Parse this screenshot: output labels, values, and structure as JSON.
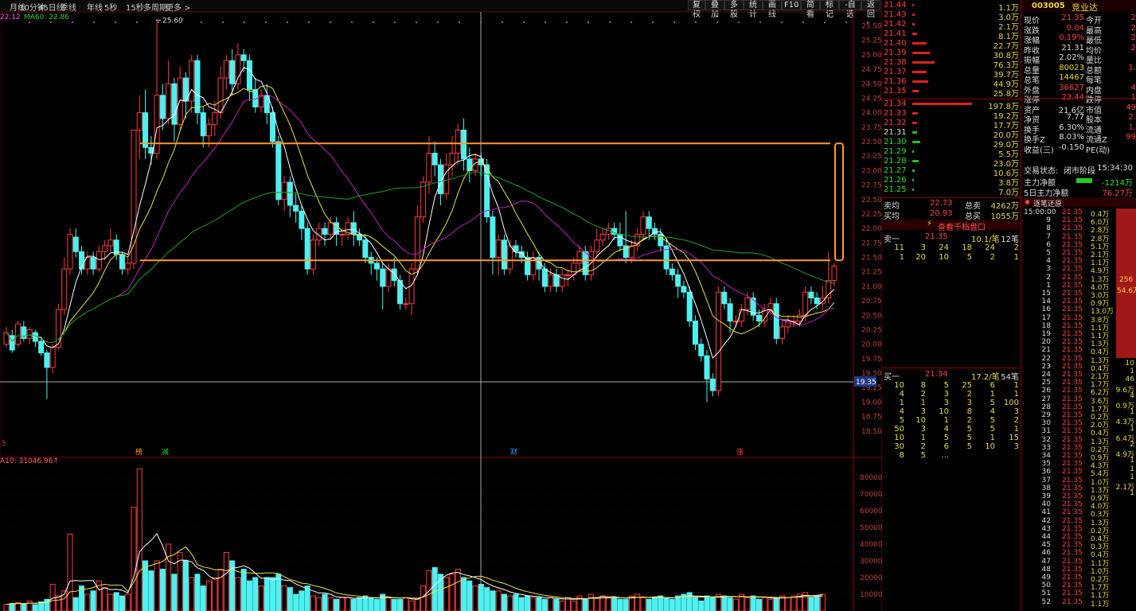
{
  "periods": [
    "月线",
    "10分钟",
    "45日线",
    "季线",
    "年线",
    "5秒",
    "15秒",
    "多周期",
    "更多 >"
  ],
  "toolbar": [
    "复权",
    "叠加",
    "多股",
    "统计",
    "画线",
    "F10",
    "简看",
    "标记",
    "-自选",
    "返回"
  ],
  "ma_legend": {
    "ma_partial": "22.12",
    "ma60": "MA60: 22.86"
  },
  "price_axis": [
    "25.50",
    "25.25",
    "25.00",
    "24.75",
    "24.50",
    "24.25",
    "24.00",
    "23.75",
    "23.50",
    "23.25",
    "23.00",
    "22.75",
    "22.50",
    "22.25",
    "22.00",
    "21.75",
    "21.50",
    "21.25",
    "21.00",
    "20.75",
    "20.50",
    "20.25",
    "20.00",
    "19.75",
    "19.50",
    "19.25",
    "19.00",
    "18.75",
    "18.50"
  ],
  "price_marker": "19.35",
  "high_label": "25.60",
  "chart_left_label": "5",
  "event_markers": [
    "榜",
    "减",
    "财",
    "涨"
  ],
  "vol_header": "A10: 31046.96↑",
  "vol_axis": [
    "80000",
    "70000",
    "60000",
    "50000",
    "40000",
    "30000",
    "20000",
    "10000"
  ],
  "candles": [
    [
      20.0,
      20.2,
      19.95,
      20.3
    ],
    [
      20.15,
      19.9,
      19.85,
      20.25
    ],
    [
      20.0,
      20.35,
      19.95,
      20.4
    ],
    [
      20.3,
      20.1,
      20.05,
      20.4
    ],
    [
      20.1,
      20.25,
      20.0,
      20.3
    ],
    [
      20.2,
      20.05,
      19.95,
      20.25
    ],
    [
      20.05,
      19.85,
      19.8,
      20.1
    ],
    [
      19.85,
      19.6,
      19.05,
      19.9
    ],
    [
      19.6,
      19.95,
      19.5,
      20.0
    ],
    [
      19.95,
      20.6,
      19.9,
      20.7
    ],
    [
      20.6,
      21.3,
      20.5,
      21.5
    ],
    [
      21.3,
      21.9,
      21.2,
      22.0
    ],
    [
      21.85,
      21.6,
      21.5,
      22.0
    ],
    [
      21.6,
      21.3,
      21.2,
      21.7
    ],
    [
      21.3,
      21.5,
      21.2,
      21.6
    ],
    [
      21.5,
      21.3,
      21.2,
      21.6
    ],
    [
      21.3,
      21.6,
      21.25,
      21.7
    ],
    [
      21.6,
      21.7,
      21.45,
      21.8
    ],
    [
      21.7,
      21.8,
      21.6,
      22.0
    ],
    [
      21.8,
      21.55,
      21.45,
      21.9
    ],
    [
      21.55,
      21.3,
      21.2,
      21.6
    ],
    [
      21.3,
      21.4,
      21.2,
      21.5
    ],
    [
      21.4,
      23.7,
      21.3,
      23.7
    ],
    [
      23.7,
      24.0,
      23.2,
      24.3
    ],
    [
      24.0,
      23.4,
      23.2,
      24.4
    ],
    [
      23.4,
      23.3,
      23.1,
      23.6
    ],
    [
      23.3,
      24.3,
      23.2,
      25.6
    ],
    [
      24.3,
      23.9,
      23.7,
      24.5
    ],
    [
      23.9,
      24.5,
      23.8,
      24.9
    ],
    [
      24.5,
      23.8,
      23.5,
      24.6
    ],
    [
      23.8,
      24.6,
      23.7,
      24.8
    ],
    [
      24.6,
      24.2,
      23.9,
      24.7
    ],
    [
      24.2,
      24.9,
      24.0,
      25.0
    ],
    [
      24.9,
      24.0,
      23.8,
      25.0
    ],
    [
      24.0,
      23.6,
      23.4,
      24.1
    ],
    [
      23.6,
      23.8,
      23.4,
      23.9
    ],
    [
      23.8,
      24.0,
      23.6,
      24.2
    ],
    [
      24.0,
      24.6,
      23.9,
      24.8
    ],
    [
      24.6,
      24.9,
      24.4,
      25.0
    ],
    [
      24.9,
      24.5,
      24.3,
      25.1
    ],
    [
      24.5,
      25.0,
      24.4,
      25.2
    ],
    [
      25.0,
      24.9,
      24.7,
      25.1
    ],
    [
      24.9,
      24.4,
      24.2,
      25.0
    ],
    [
      24.4,
      24.1,
      24.0,
      24.6
    ],
    [
      24.1,
      24.3,
      24.0,
      24.4
    ],
    [
      24.3,
      24.0,
      23.8,
      24.5
    ],
    [
      24.0,
      23.5,
      23.4,
      24.1
    ],
    [
      23.5,
      22.5,
      22.4,
      23.6
    ],
    [
      22.5,
      22.8,
      22.3,
      22.9
    ],
    [
      22.8,
      22.4,
      22.2,
      22.9
    ],
    [
      22.4,
      22.3,
      22.1,
      22.6
    ],
    [
      22.3,
      22.0,
      21.8,
      22.4
    ],
    [
      22.0,
      21.3,
      21.2,
      22.1
    ],
    [
      21.3,
      21.8,
      21.2,
      21.9
    ],
    [
      21.8,
      22.0,
      21.7,
      22.1
    ],
    [
      22.0,
      21.9,
      21.7,
      22.1
    ],
    [
      21.9,
      22.1,
      21.8,
      22.2
    ],
    [
      22.1,
      21.9,
      21.7,
      22.2
    ],
    [
      21.9,
      21.9,
      21.7,
      22.0
    ],
    [
      21.9,
      22.1,
      21.8,
      22.2
    ],
    [
      22.1,
      21.9,
      21.7,
      22.3
    ],
    [
      21.9,
      21.8,
      21.7,
      22.0
    ],
    [
      21.8,
      21.5,
      21.4,
      21.9
    ],
    [
      21.5,
      21.4,
      21.2,
      21.6
    ],
    [
      21.4,
      21.3,
      21.1,
      21.5
    ],
    [
      21.3,
      21.0,
      20.6,
      21.4
    ],
    [
      21.0,
      21.3,
      20.9,
      21.4
    ],
    [
      21.3,
      21.1,
      21.0,
      21.5
    ],
    [
      21.1,
      20.7,
      20.6,
      21.2
    ],
    [
      20.7,
      20.7,
      20.6,
      20.8
    ],
    [
      20.7,
      21.3,
      20.5,
      21.4
    ],
    [
      21.3,
      22.2,
      21.2,
      22.4
    ],
    [
      22.2,
      22.8,
      22.1,
      22.9
    ],
    [
      22.8,
      23.3,
      22.6,
      23.6
    ],
    [
      23.3,
      23.1,
      22.9,
      23.5
    ],
    [
      23.1,
      22.6,
      22.4,
      23.2
    ],
    [
      22.6,
      23.1,
      22.5,
      23.3
    ],
    [
      23.1,
      23.3,
      22.9,
      23.6
    ],
    [
      23.3,
      23.7,
      23.1,
      23.8
    ],
    [
      23.7,
      23.2,
      23.0,
      23.9
    ],
    [
      23.2,
      23.0,
      22.8,
      23.4
    ],
    [
      23.0,
      23.2,
      22.9,
      23.3
    ],
    [
      23.2,
      23.1,
      22.9,
      23.3
    ],
    [
      23.1,
      22.2,
      22.1,
      23.2
    ],
    [
      22.2,
      21.5,
      21.2,
      22.3
    ],
    [
      21.5,
      21.8,
      21.2,
      21.9
    ],
    [
      21.8,
      21.3,
      21.2,
      21.9
    ],
    [
      21.3,
      21.7,
      21.2,
      21.8
    ],
    [
      21.7,
      21.6,
      21.5,
      21.8
    ],
    [
      21.6,
      21.5,
      21.4,
      21.7
    ],
    [
      21.5,
      21.2,
      21.1,
      21.6
    ],
    [
      21.2,
      21.5,
      21.1,
      21.6
    ],
    [
      21.5,
      21.3,
      21.1,
      21.6
    ],
    [
      21.3,
      21.0,
      20.9,
      21.4
    ],
    [
      21.0,
      21.2,
      20.9,
      21.3
    ],
    [
      21.2,
      21.0,
      20.9,
      21.3
    ],
    [
      21.0,
      21.2,
      20.9,
      21.3
    ],
    [
      21.2,
      21.2,
      21.0,
      21.3
    ],
    [
      21.2,
      21.4,
      21.1,
      21.5
    ],
    [
      21.4,
      21.6,
      21.3,
      21.7
    ],
    [
      21.6,
      21.2,
      21.1,
      21.7
    ],
    [
      21.2,
      21.6,
      21.1,
      21.7
    ],
    [
      21.6,
      21.8,
      21.5,
      22.0
    ],
    [
      21.8,
      21.9,
      21.7,
      22.0
    ],
    [
      21.9,
      22.0,
      21.8,
      22.1
    ],
    [
      22.0,
      21.9,
      21.8,
      22.1
    ],
    [
      21.9,
      21.7,
      21.6,
      22.1
    ],
    [
      21.7,
      21.5,
      21.4,
      22.3
    ],
    [
      21.5,
      21.7,
      21.4,
      21.8
    ],
    [
      21.7,
      21.9,
      21.6,
      22.0
    ],
    [
      21.9,
      22.2,
      21.8,
      22.3
    ],
    [
      22.2,
      22.0,
      21.8,
      22.3
    ],
    [
      22.0,
      21.9,
      21.8,
      22.1
    ],
    [
      21.9,
      21.7,
      21.6,
      22.0
    ],
    [
      21.7,
      21.3,
      21.2,
      21.8
    ],
    [
      21.3,
      21.2,
      21.1,
      21.4
    ],
    [
      21.2,
      21.0,
      20.8,
      21.3
    ],
    [
      21.0,
      20.9,
      20.8,
      21.1
    ],
    [
      20.9,
      20.4,
      20.3,
      21.0
    ],
    [
      20.4,
      20.0,
      19.9,
      20.5
    ],
    [
      20.0,
      19.8,
      19.7,
      20.1
    ],
    [
      19.8,
      19.4,
      19.0,
      19.9
    ],
    [
      19.4,
      19.2,
      19.1,
      19.5
    ],
    [
      19.2,
      20.9,
      19.1,
      21.0
    ],
    [
      20.9,
      20.7,
      20.6,
      21.0
    ],
    [
      20.7,
      20.4,
      20.2,
      20.8
    ],
    [
      20.4,
      20.4,
      20.3,
      20.5
    ],
    [
      20.4,
      20.6,
      20.3,
      20.7
    ],
    [
      20.6,
      20.8,
      20.5,
      20.9
    ],
    [
      20.8,
      20.5,
      20.4,
      20.9
    ],
    [
      20.5,
      20.4,
      20.3,
      20.6
    ],
    [
      20.4,
      20.6,
      20.3,
      20.7
    ],
    [
      20.6,
      20.7,
      20.5,
      20.8
    ],
    [
      20.7,
      20.1,
      20.0,
      20.8
    ],
    [
      20.1,
      20.3,
      20.0,
      20.4
    ],
    [
      20.3,
      20.4,
      20.2,
      20.5
    ],
    [
      20.4,
      20.4,
      20.3,
      20.5
    ],
    [
      20.4,
      20.5,
      20.3,
      20.6
    ],
    [
      20.5,
      20.9,
      20.4,
      21.0
    ],
    [
      20.9,
      20.8,
      20.7,
      21.0
    ],
    [
      20.8,
      20.7,
      20.6,
      20.9
    ],
    [
      20.7,
      20.8,
      20.6,
      21.0
    ],
    [
      20.8,
      21.1,
      20.7,
      21.6
    ],
    [
      21.1,
      21.35,
      21.0,
      21.4
    ]
  ],
  "volumes": [
    4000,
    4500,
    5000,
    4200,
    6000,
    3800,
    5500,
    7000,
    16000,
    9000,
    12000,
    46000,
    8000,
    15000,
    10000,
    12000,
    18000,
    14000,
    10000,
    11000,
    9000,
    10000,
    62000,
    85000,
    30000,
    24000,
    30000,
    25000,
    40000,
    22000,
    35000,
    30000,
    20000,
    22000,
    15000,
    18000,
    20000,
    25000,
    35000,
    30000,
    20000,
    25000,
    18000,
    20000,
    15000,
    20000,
    20000,
    22000,
    15000,
    14000,
    10000,
    12000,
    15000,
    9000,
    8000,
    10000,
    8000,
    7000,
    8000,
    8000,
    7000,
    8000,
    9000,
    8000,
    7000,
    10000,
    8000,
    7000,
    7000,
    8000,
    6000,
    7000,
    15000,
    24000,
    26000,
    22000,
    20000,
    22000,
    25000,
    20000,
    18000,
    15000,
    16000,
    14000,
    12000,
    12000,
    10000,
    9000,
    10000,
    8000,
    9000,
    8000,
    8000,
    7000,
    8000,
    7000,
    6000,
    8000,
    6000,
    9000,
    7000,
    10000,
    8000,
    9000,
    8000,
    8000,
    7000,
    7000,
    9000,
    10000,
    8000,
    7000,
    8000,
    9000,
    8000,
    7000,
    9000,
    10000,
    11000,
    8000,
    6000,
    9000,
    8000,
    10000,
    9000,
    8000,
    7000,
    10000,
    8000,
    9000,
    7000,
    8000,
    7000,
    8000,
    9000,
    8000,
    9000,
    10000,
    11000,
    8000,
    9000,
    10000
  ],
  "right_panel": {
    "ask_rows": [
      [
        "21.44",
        "1.1万"
      ],
      [
        "21.43",
        "3.0万"
      ],
      [
        "21.42",
        "2.1万"
      ],
      [
        "21.41",
        "8.1万"
      ],
      [
        "21.40",
        "22.7万"
      ],
      [
        "21.39",
        "30.8万"
      ],
      [
        "21.38",
        "76.3万"
      ],
      [
        "21.37",
        "39.7万"
      ],
      [
        "21.36",
        "44.9万"
      ],
      [
        "21.35",
        "25.8万"
      ]
    ],
    "bid_rows": [
      [
        "21.34",
        "197.8万"
      ],
      [
        "21.33",
        "19.2万"
      ],
      [
        "21.32",
        "17.7万"
      ],
      [
        "21.31",
        "20.0万"
      ],
      [
        "21.30",
        "29.0万"
      ],
      [
        "21.29",
        "5.5万"
      ],
      [
        "21.28",
        "23.0万"
      ],
      [
        "21.27",
        "10.6万"
      ],
      [
        "21.26",
        "3.8万"
      ],
      [
        "21.25",
        "7.0万"
      ]
    ],
    "summary": [
      [
        "卖均",
        "22.73",
        "总卖",
        "4262万"
      ],
      [
        "买均",
        "20.93",
        "总买",
        "1055万"
      ]
    ],
    "view_link": "查看千档盘口",
    "sell1": [
      "卖一",
      "21.35",
      "10.1/笔",
      "12笔"
    ],
    "sell_grid": [
      [
        "11",
        "3",
        "24",
        "18",
        "24",
        "2"
      ],
      [
        "1",
        "20",
        "10",
        "5",
        "2",
        "1"
      ]
    ],
    "buy1": [
      "买一",
      "21.34",
      "17.2/笔",
      "54笔"
    ],
    "buy_grid": [
      [
        "10",
        "8",
        "5",
        "25",
        "6",
        "1"
      ],
      [
        "4",
        "2",
        "3",
        "2",
        "1",
        "1"
      ],
      [
        "1",
        "1",
        "3",
        "3",
        "5",
        "100"
      ],
      [
        "4",
        "3",
        "10",
        "8",
        "4",
        "3"
      ],
      [
        "5",
        "10",
        "1",
        "2",
        "5",
        "2"
      ],
      [
        "50",
        "3",
        "4",
        "5",
        "5",
        "1"
      ],
      [
        "10",
        "1",
        "5",
        "5",
        "1",
        "15"
      ],
      [
        "30",
        "2",
        "6",
        "5",
        "10",
        "3"
      ],
      [
        "8",
        "5",
        "...",
        "",
        "",
        ""
      ]
    ]
  },
  "quote": {
    "code": "003005",
    "name": "竞业达",
    "rows": [
      [
        "现价",
        "21.35",
        "今开",
        "2"
      ],
      [
        "涨跌",
        "0.04",
        "最高",
        "2"
      ],
      [
        "涨幅",
        "0.19%",
        "最低",
        "2"
      ],
      [
        "昨收",
        "21.31",
        "均价",
        "2"
      ],
      [
        "振幅",
        "2.02%",
        "量比",
        ""
      ],
      [
        "总量",
        "80023",
        "总额",
        "1."
      ],
      [
        "总笔",
        "14467",
        "每笔",
        ""
      ],
      [
        "外盘",
        "36627",
        "内盘",
        "4"
      ],
      [
        "涨停",
        "23.44",
        "跌停",
        "1"
      ],
      [
        "资产",
        "21.6亿",
        "市值",
        "49"
      ],
      [
        "净资",
        "7.77",
        "股本",
        "2."
      ],
      [
        "换手",
        "6.30%",
        "流通",
        "1."
      ],
      [
        "换手Z",
        "8.03%",
        "流通Z",
        "99"
      ],
      [
        "收益(三)",
        "-0.150",
        "PE(动)",
        ""
      ]
    ],
    "trade_status": "交易状态:",
    "trade_status_value": "闭市阶段",
    "trade_time": "15:34:30",
    "mainforce": "主力净额",
    "mainforce_value": "-1214万",
    "mainforce5": "5日主力净额",
    "mainforce5_value": "76.27万",
    "tick_tab": "逐笔还原"
  },
  "ticks": {
    "time": "15:00:00",
    "rows": [
      [
        "",
        "21.35",
        "0.4万"
      ],
      [
        "9",
        "21.35",
        "6.0万"
      ],
      [
        "8",
        "21.35",
        "2.8万"
      ],
      [
        "7",
        "21.35",
        "2.8万"
      ],
      [
        "6",
        "21.35",
        "5.1万"
      ],
      [
        "5",
        "21.35",
        "2.1万"
      ],
      [
        "4",
        "21.35",
        "1.1万"
      ],
      [
        "3",
        "21.35",
        "4.9万"
      ],
      [
        "2",
        "21.35",
        "1.3万"
      ],
      [
        "1",
        "21.35",
        "4.0万"
      ],
      [
        "15",
        "21.35",
        "3.0万"
      ],
      [
        "14",
        "21.35",
        "0.9万"
      ],
      [
        "16",
        "21.35",
        "13.0万"
      ],
      [
        "17",
        "21.35",
        "3.8万"
      ],
      [
        "18",
        "21.35",
        "1.1万"
      ],
      [
        "19",
        "21.35",
        "1.1万"
      ],
      [
        "20",
        "21.35",
        "1.3万"
      ],
      [
        "21",
        "21.35",
        "0.4万"
      ],
      [
        "22",
        "21.35",
        "1.3万"
      ],
      [
        "23",
        "21.35",
        "0.4万"
      ],
      [
        "24",
        "21.35",
        "2.1万"
      ],
      [
        "25",
        "21.35",
        "1.7万"
      ],
      [
        "26",
        "21.35",
        "6.2万"
      ],
      [
        "27",
        "21.35",
        "3.6万"
      ],
      [
        "28",
        "21.35",
        "1.7万"
      ],
      [
        "29",
        "21.35",
        "0.2万"
      ],
      [
        "30",
        "21.35",
        "2.0万"
      ],
      [
        "31",
        "21.35",
        "0.4万"
      ],
      [
        "32",
        "21.35",
        "1.3万"
      ],
      [
        "33",
        "21.35",
        "0.2万"
      ],
      [
        "34",
        "21.35",
        "0.9万"
      ],
      [
        "35",
        "21.35",
        "4.3万"
      ],
      [
        "36",
        "21.35",
        "5.4万"
      ],
      [
        "37",
        "21.35",
        "1.0万"
      ],
      [
        "38",
        "21.35",
        "1.3万"
      ],
      [
        "39",
        "21.35",
        "0.9万"
      ],
      [
        "40",
        "21.35",
        "4.0万"
      ],
      [
        "41",
        "21.35",
        "0.3万"
      ],
      [
        "42",
        "21.35",
        "1.3万"
      ],
      [
        "43",
        "21.35",
        "0.2万"
      ],
      [
        "44",
        "21.35",
        "0.4万"
      ],
      [
        "45",
        "21.35",
        "0.3万"
      ],
      [
        "46",
        "21.35",
        "0.4万"
      ],
      [
        "47",
        "21.35",
        "1.1万"
      ],
      [
        "48",
        "21.35",
        "1.0万"
      ],
      [
        "49",
        "21.35",
        "0.2万"
      ],
      [
        "50",
        "21.35",
        "1.7万"
      ],
      [
        "51",
        "21.35",
        "1.1万"
      ],
      [
        "52",
        "21.35",
        "1.1万"
      ]
    ],
    "bar_top": "256",
    "bar_sub": "54.6万",
    "side_vals": [
      [
        "10",
        ""
      ],
      [
        "1",
        ""
      ],
      [
        "46",
        ""
      ],
      [
        "9.6万",
        ""
      ],
      [
        "4",
        ""
      ],
      [
        "0.9万",
        ""
      ],
      [
        "1",
        ""
      ],
      [
        "4.3万",
        ""
      ],
      [
        "1",
        ""
      ],
      [
        "6.4万",
        ""
      ],
      [
        "2",
        ""
      ],
      [
        "4.9万",
        ""
      ],
      [
        "1",
        ""
      ],
      [
        "1",
        ""
      ],
      [
        "1",
        ""
      ],
      [
        "2.1万",
        ""
      ],
      [
        "1",
        ""
      ]
    ]
  }
}
